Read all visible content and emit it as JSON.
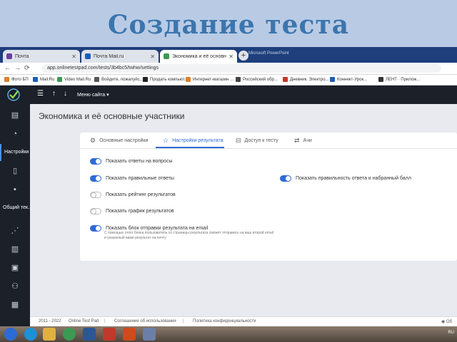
{
  "slide": {
    "title": "Создание теста"
  },
  "browser": {
    "tabs": [
      {
        "label": "Почта",
        "favicon_color": "#6b3fa0"
      },
      {
        "label": "Почта Mail.ru",
        "favicon_color": "#1b5eb8"
      },
      {
        "label": "Экономика и её основные уча",
        "favicon_color": "#3a9a53"
      }
    ],
    "new_tab": "+",
    "corner_text": "Microsoft PowerPoint",
    "url": "app.onlinetestpad.com/tests/3b4bc5/twhw/settings",
    "bookmarks": [
      {
        "label": "Фото БП",
        "color": "#d9822b"
      },
      {
        "label": "Mail.Ru",
        "color": "#1b5eb8"
      },
      {
        "label": "Video Mail.Ru",
        "color": "#3a9a53"
      },
      {
        "label": "Войдите, пожалуйс...",
        "color": "#555555"
      },
      {
        "label": "Продать компьют...",
        "color": "#222222"
      },
      {
        "label": "Интернет-магазин ...",
        "color": "#d9822b"
      },
      {
        "label": "Российский обр...",
        "color": "#444444"
      },
      {
        "label": "Дневник. Электро...",
        "color": "#c0392b"
      },
      {
        "label": "Коннект-Урок...",
        "color": "#1b5eb8"
      },
      {
        "label": "ЛЕНТ · Прилож...",
        "color": "#333333"
      }
    ]
  },
  "app": {
    "header": {
      "menu_label": "Меню сайта"
    },
    "sidebar": {
      "settings_label": "Настройки",
      "general_label": "Общий тек..."
    },
    "page_title": "Экономика и её основные участники",
    "settings_tabs": [
      {
        "label": "Основные настройки",
        "icon": "gear-icon"
      },
      {
        "label": "Настройки результата",
        "icon": "star-icon"
      },
      {
        "label": "Доступ к тесту",
        "icon": "lock-icon"
      },
      {
        "label": "Ачи",
        "icon": "sliders-icon"
      }
    ],
    "options": [
      {
        "label": "Показать ответы на вопросы",
        "on": true
      },
      {
        "label": "Показать правильные ответы",
        "on": true
      },
      {
        "label": "Показать рейтинг результатов",
        "on": false
      },
      {
        "label": "Показать график результатов",
        "on": false
      },
      {
        "label": "Показать блок отправки результата на email",
        "on": true
      },
      {
        "label": "Показать правильность ответа и набранный балл",
        "on": true
      }
    ],
    "email_hint": "С помощью этого блока пользователь со страницы результата сможет отправить на ваш второй email и указанный вами результат на почту",
    "footer": {
      "copyright": "2011 - 2022",
      "links": [
        "Online Test Pad",
        "Соглашение об использовании",
        "Политика конфиденциальности"
      ],
      "right": "Об"
    }
  },
  "taskbar": {
    "right_text": "RU",
    "apps": [
      {
        "name": "start-icon",
        "color": "#2d6bd4"
      },
      {
        "name": "ie-icon",
        "color": "#1e90d6"
      },
      {
        "name": "explorer-icon",
        "color": "#e0b040"
      },
      {
        "name": "chrome-icon",
        "color": "#3a9a53"
      },
      {
        "name": "word-icon",
        "color": "#2b5797"
      },
      {
        "name": "filezilla-icon",
        "color": "#c0392b"
      },
      {
        "name": "powerpoint-icon",
        "color": "#d04a1a"
      },
      {
        "name": "settings-icon",
        "color": "#6b7fa8"
      }
    ]
  }
}
